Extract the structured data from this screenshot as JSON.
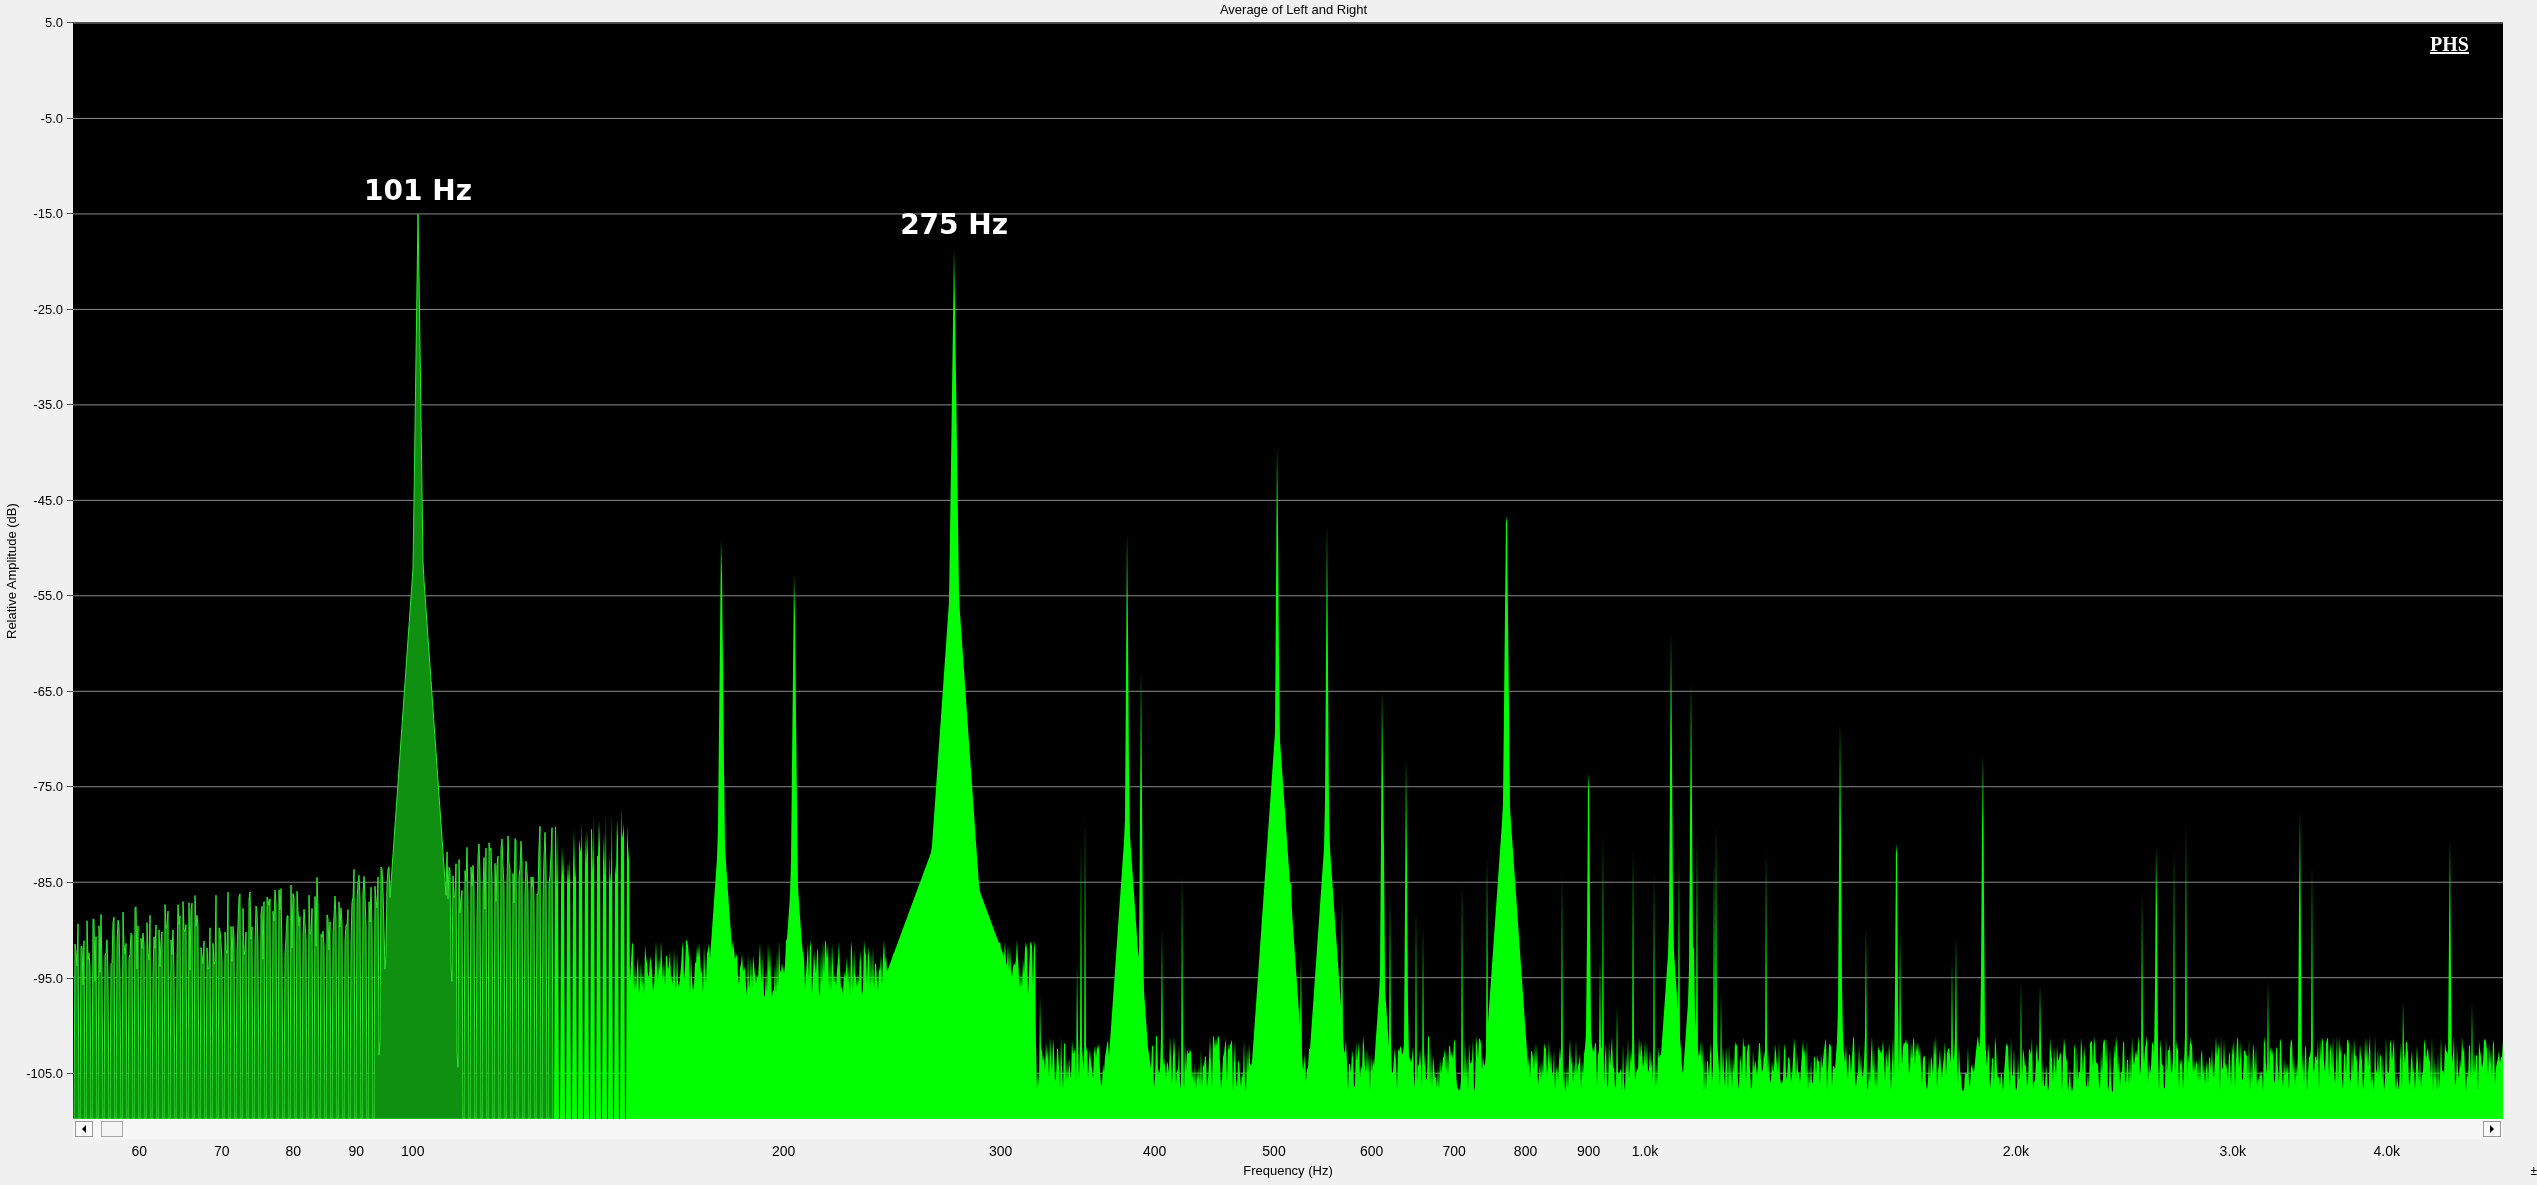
{
  "window": {
    "title": "Average of Left and Right"
  },
  "logo": "PHS",
  "spectrum": {
    "xlabel": "Frequency (Hz)",
    "ylabel": "Relative Amplitude (dB)",
    "xticks": [
      "60",
      "70",
      "80",
      "90",
      "100",
      "200",
      "300",
      "400",
      "500",
      "600",
      "700",
      "800",
      "900",
      "1.0k",
      "2.0k",
      "3.0k",
      "4.0k"
    ],
    "yticks": [
      "5.0",
      "-5.0",
      "-15.0",
      "-25.0",
      "-35.0",
      "-45.0",
      "-55.0",
      "-65.0",
      "-75.0",
      "-85.0",
      "-95.0",
      "-105.0"
    ],
    "annotations": [
      "101 Hz",
      "275 Hz"
    ]
  },
  "corner_mark": "±"
}
